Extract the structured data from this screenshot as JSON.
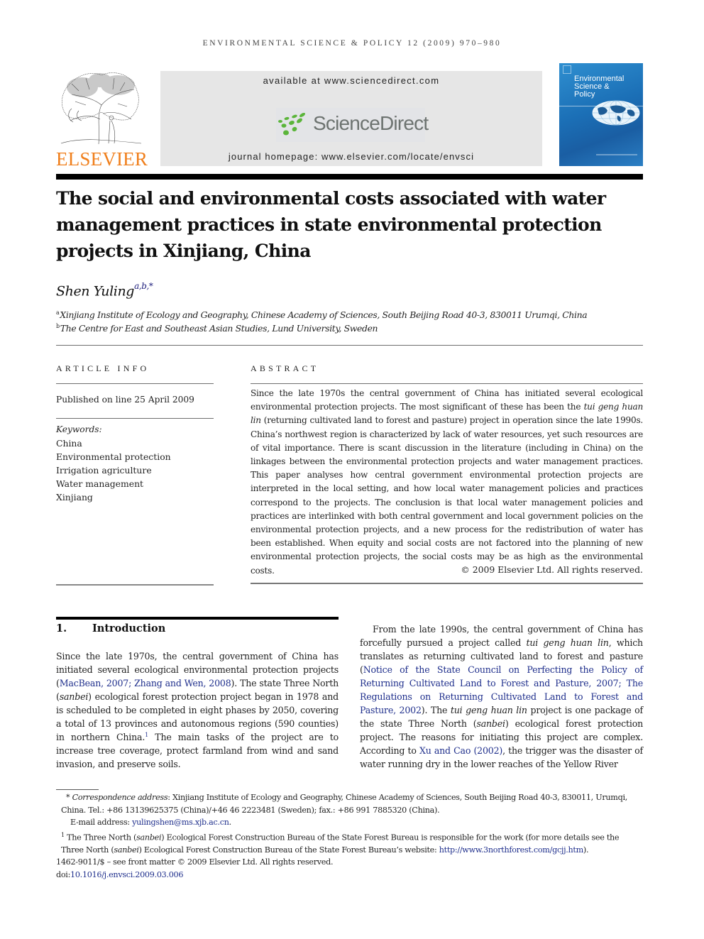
{
  "running_head": "ENVIRONMENTAL SCIENCE & POLICY 12 (2009) 970–980",
  "header": {
    "publisher_logo_text": "ELSEVIER",
    "available_at": "available at www.sciencedirect.com",
    "sciencedirect_logo_text": "ScienceDirect",
    "journal_homepage": "journal homepage: www.elsevier.com/locate/envsci",
    "cover": {
      "title_line1": "Environmental",
      "title_line2": "Science &",
      "title_line3": "Policy"
    },
    "colors": {
      "elsevier_orange": "#f07f1c",
      "sciencedirect_green": "#5bb53a",
      "sciencedirect_gray": "#6d7370",
      "cover_blue": "#1b6fb6",
      "link_blue": "#1f2f8c"
    }
  },
  "article": {
    "title": "The social and environmental costs associated with water management practices in state environmental protection projects in Xinjiang, China",
    "author": "Shen Yuling",
    "author_marks": "a,b,*",
    "affiliations": [
      {
        "mark": "a",
        "text": "Xinjiang Institute of Ecology and Geography, Chinese Academy of Sciences, South Beijing Road 40-3, 830011 Urumqi, China"
      },
      {
        "mark": "b",
        "text": "The Centre for East and Southeast Asian Studies, Lund University, Sweden"
      }
    ]
  },
  "article_info": {
    "heading": "ARTICLE INFO",
    "published": "Published on line 25 April 2009",
    "keywords_label": "Keywords:",
    "keywords": [
      "China",
      "Environmental protection",
      "Irrigation agriculture",
      "Water management",
      "Xinjiang"
    ]
  },
  "abstract": {
    "heading": "ABSTRACT",
    "part1": "Since the late 1970s the central government of China has initiated several ecological environmental protection projects. The most significant of these has been the ",
    "italic1": "tui geng huan lin",
    "part2": " (returning cultivated land to forest and pasture) project in operation since the late 1990s. China’s northwest region is characterized by lack of water resources, yet such resources are of vital importance. There is scant discussion in the literature (including in China) on the linkages between the environmental protection projects and water management practices. This paper analyses how central government environmental protection projects are interpreted in the local setting, and how local water management policies and practices correspond to the projects. The conclusion is that local water management policies and practices are interlinked with both central government and local government policies on the environmental protection projects, and a new process for the redistribution of water has been established. When equity and social costs are not factored into the planning of new environmental protection projects, the social costs may be as high as the environmental costs.",
    "copyright": "© 2009 Elsevier Ltd. All rights reserved."
  },
  "introduction": {
    "number": "1.",
    "heading": "Introduction",
    "left": {
      "t1": "Since the late 1970s, the central government of China has initiated several ecological environmental protection projects (",
      "ref1": "MacBean, 2007; Zhang and Wen, 2008",
      "t2": "). The state Three North (",
      "i1": "sanbei",
      "t3": ") ecological forest protection project began in 1978 and is scheduled to be completed in eight phases by 2050, covering a total of 13 provinces and autonomous regions (590 counties) in northern China.",
      "fn1": "1",
      "t4": " The main tasks of the project are to increase tree coverage, protect farmland from wind and sand invasion, and preserve soils."
    },
    "right": {
      "t1": "From the late 1990s, the central government of China has forcefully pursued a project called ",
      "i1": "tui geng huan lin",
      "t2": ", which translates as returning cultivated land to forest and pasture (",
      "ref1": "Notice of the State Council on Perfecting the Policy of Returning Cultivated Land to Forest and Pasture, 2007; The Regulations on Returning Cultivated Land to Forest and Pasture, 2002",
      "t3": "). The ",
      "i2": "tui geng huan lin",
      "t4": " project is one package of the state Three North (",
      "i3": "sanbei",
      "t5": ") ecological forest protection project. The reasons for initiating this project are complex. According to ",
      "ref2": "Xu and Cao (2002)",
      "t6": ", the trigger was the disaster of water running dry in the lower reaches of the Yellow River"
    }
  },
  "footnotes": {
    "corr_mark": "*",
    "corr_label": "Correspondence address",
    "corr_text": ": Xinjiang Institute of Ecology and Geography, Chinese Academy of Sciences, South Beijing Road 40-3, 830011, Urumqi, China. Tel.: +86 13139625375 (China)/+46 46 2223481 (Sweden); fax.: +86 991 7885320 (China).",
    "email_label": "E-mail address: ",
    "email": "yulingshen@ms.xjb.ac.cn",
    "email_end": ".",
    "fn1_mark": "1",
    "fn1_t1": " The Three North (",
    "fn1_i1": "sanbei",
    "fn1_t2": ") Ecological Forest Construction Bureau of the State Forest Bureau is responsible for the work (for more details see the Three North (",
    "fn1_i2": "sanbei",
    "fn1_t3": ") Ecological Forest Construction Bureau of the State Forest Bureau’s website: ",
    "fn1_url": "http://www.3northforest.com/gcjj.htm",
    "fn1_end": ").",
    "front_matter": "1462-9011/$ – see front matter © 2009 Elsevier Ltd. All rights reserved.",
    "doi_label": "doi:",
    "doi": "10.1016/j.envsci.2009.03.006"
  }
}
